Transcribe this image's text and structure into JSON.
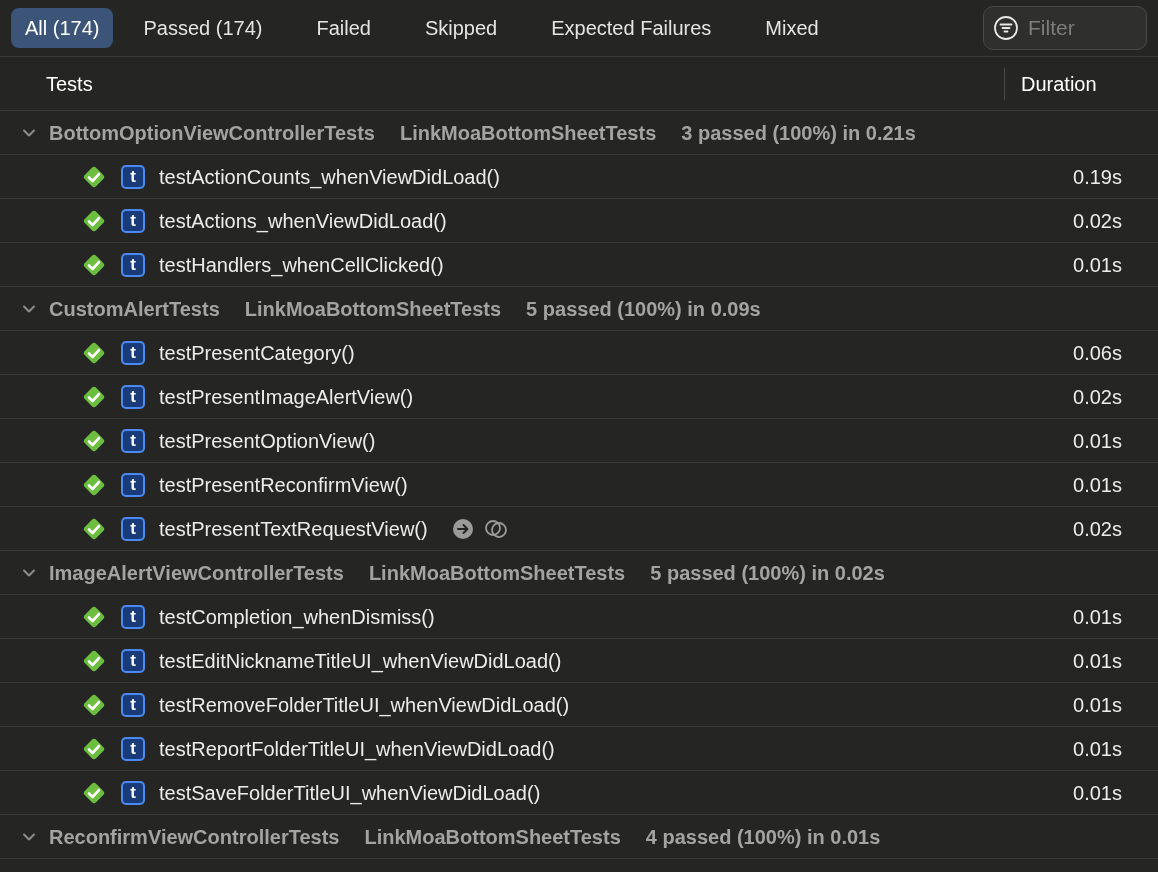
{
  "tabs": [
    {
      "label": "All (174)",
      "selected": true
    },
    {
      "label": "Passed (174)",
      "selected": false
    },
    {
      "label": "Failed",
      "selected": false
    },
    {
      "label": "Skipped",
      "selected": false
    },
    {
      "label": "Expected Failures",
      "selected": false
    },
    {
      "label": "Mixed",
      "selected": false
    }
  ],
  "filter": {
    "placeholder": "Filter"
  },
  "columns": [
    "Tests",
    "Duration"
  ],
  "groups": [
    {
      "name": "BottomOptionViewControllerTests",
      "target": "LinkMoaBottomSheetTests",
      "summary": "3 passed (100%) in 0.21s",
      "expanded": true,
      "tests": [
        {
          "badge": "t",
          "name": "testActionCounts_whenViewDidLoad()",
          "duration": "0.19s",
          "passed": true,
          "actions": false
        },
        {
          "badge": "t",
          "name": "testActions_whenViewDidLoad()",
          "duration": "0.02s",
          "passed": true,
          "actions": false
        },
        {
          "badge": "t",
          "name": "testHandlers_whenCellClicked()",
          "duration": "0.01s",
          "passed": true,
          "actions": false
        }
      ]
    },
    {
      "name": "CustomAlertTests",
      "target": "LinkMoaBottomSheetTests",
      "summary": "5 passed (100%) in 0.09s",
      "expanded": true,
      "tests": [
        {
          "badge": "t",
          "name": "testPresentCategory()",
          "duration": "0.06s",
          "passed": true,
          "actions": false
        },
        {
          "badge": "t",
          "name": "testPresentImageAlertView()",
          "duration": "0.02s",
          "passed": true,
          "actions": false
        },
        {
          "badge": "t",
          "name": "testPresentOptionView()",
          "duration": "0.01s",
          "passed": true,
          "actions": false
        },
        {
          "badge": "t",
          "name": "testPresentReconfirmView()",
          "duration": "0.01s",
          "passed": true,
          "actions": false
        },
        {
          "badge": "t",
          "name": "testPresentTextRequestView()",
          "duration": "0.02s",
          "passed": true,
          "actions": true
        }
      ]
    },
    {
      "name": "ImageAlertViewControllerTests",
      "target": "LinkMoaBottomSheetTests",
      "summary": "5 passed (100%) in 0.02s",
      "expanded": true,
      "tests": [
        {
          "badge": "t",
          "name": "testCompletion_whenDismiss()",
          "duration": "0.01s",
          "passed": true,
          "actions": false
        },
        {
          "badge": "t",
          "name": "testEditNicknameTitleUI_whenViewDidLoad()",
          "duration": "0.01s",
          "passed": true,
          "actions": false
        },
        {
          "badge": "t",
          "name": "testRemoveFolderTitleUI_whenViewDidLoad()",
          "duration": "0.01s",
          "passed": true,
          "actions": false
        },
        {
          "badge": "t",
          "name": "testReportFolderTitleUI_whenViewDidLoad()",
          "duration": "0.01s",
          "passed": true,
          "actions": false
        },
        {
          "badge": "t",
          "name": "testSaveFolderTitleUI_whenViewDidLoad()",
          "duration": "0.01s",
          "passed": true,
          "actions": false
        }
      ]
    },
    {
      "name": "ReconfirmViewControllerTests",
      "target": "LinkMoaBottomSheetTests",
      "summary": "4 passed (100%) in 0.01s",
      "expanded": true
    }
  ]
}
